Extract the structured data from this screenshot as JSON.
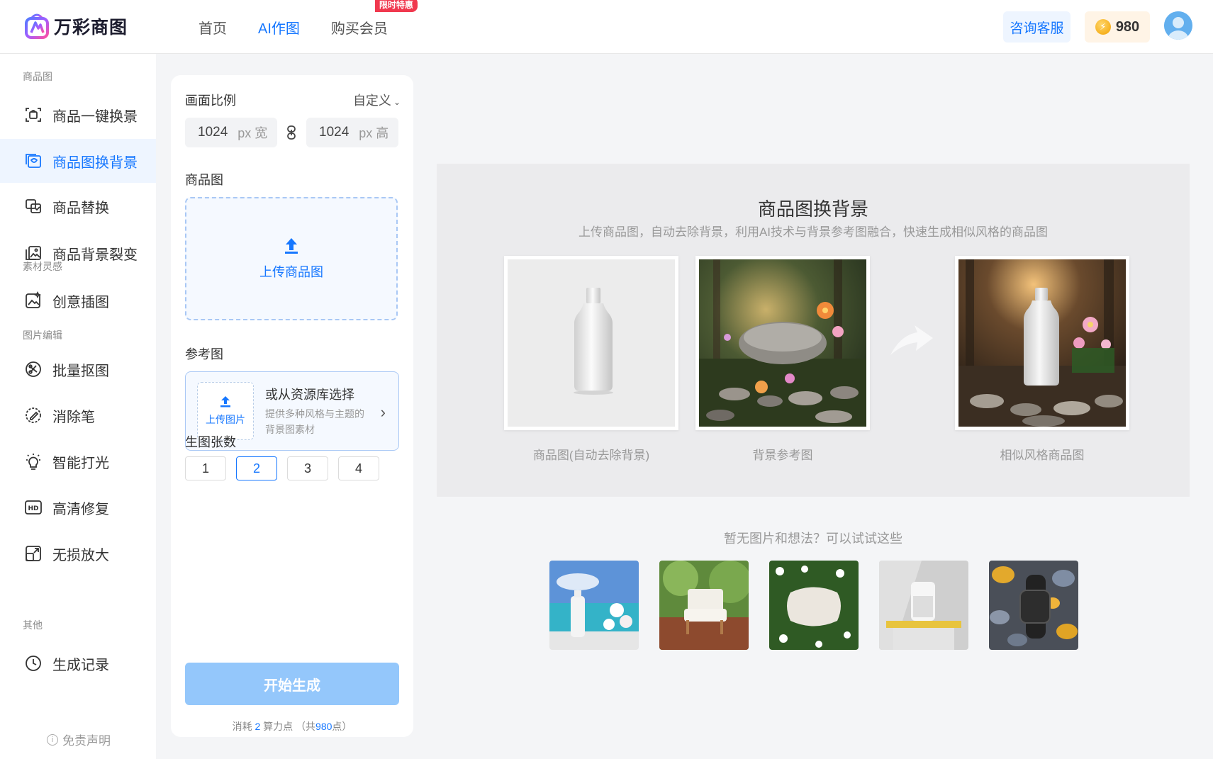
{
  "header": {
    "logo_text": "万彩商图",
    "nav": [
      {
        "label": "首页"
      },
      {
        "label": "AI作图"
      },
      {
        "label": "购买会员",
        "badge": "限时特惠"
      }
    ],
    "consult_label": "咨询客服",
    "points": "980"
  },
  "sidebar": {
    "sections": {
      "product": "商品图",
      "material": "素材灵感",
      "edit": "图片编辑",
      "other": "其他"
    },
    "items": [
      {
        "label": "商品一键换景",
        "icon": "scan-product-icon"
      },
      {
        "label": "商品图换背景",
        "icon": "image-replace-icon"
      },
      {
        "label": "商品替换",
        "icon": "swap-icon"
      },
      {
        "label": "商品背景裂变",
        "icon": "image-split-icon"
      },
      {
        "label": "创意插图",
        "icon": "creative-image-icon"
      },
      {
        "label": "批量抠图",
        "icon": "cutout-icon"
      },
      {
        "label": "消除笔",
        "icon": "eraser-icon"
      },
      {
        "label": "智能打光",
        "icon": "bulb-icon"
      },
      {
        "label": "高清修复",
        "icon": "hd-icon"
      },
      {
        "label": "无损放大",
        "icon": "enlarge-icon"
      },
      {
        "label": "生成记录",
        "icon": "clock-icon"
      }
    ],
    "disclaimer": "免责声明"
  },
  "panel": {
    "ratio_label": "画面比例",
    "ratio_value": "自定义",
    "width_value": "1024",
    "width_unit": "px 宽",
    "height_value": "1024",
    "height_unit": "px 高",
    "product_label": "商品图",
    "upload_product": "上传商品图",
    "reference_label": "参考图",
    "upload_image": "上传图片",
    "library_title": "或从资源库选择",
    "library_desc": "提供多种风格与主题的背景图素材",
    "count_label": "生图张数",
    "counts": [
      "1",
      "2",
      "3",
      "4"
    ],
    "selected_count": "2",
    "generate_label": "开始生成",
    "cost_prefix": "消耗",
    "cost_points": "2",
    "cost_mid": "算力点 （共",
    "cost_total": "980",
    "cost_suffix": "点）"
  },
  "demo": {
    "title": "商品图换背景",
    "subtitle": "上传商品图，自动去除背景，利用AI技术与背景参考图融合，快速生成相似风格的商品图",
    "captions": [
      "商品图(自动去除背景)",
      "背景参考图",
      "相似风格商品图"
    ]
  },
  "try": {
    "title": "暂无图片和想法？可以试试这些"
  },
  "colors": {
    "accent": "#1677ff",
    "generate_disabled": "#94c7fb",
    "badge": "#f0384e"
  }
}
